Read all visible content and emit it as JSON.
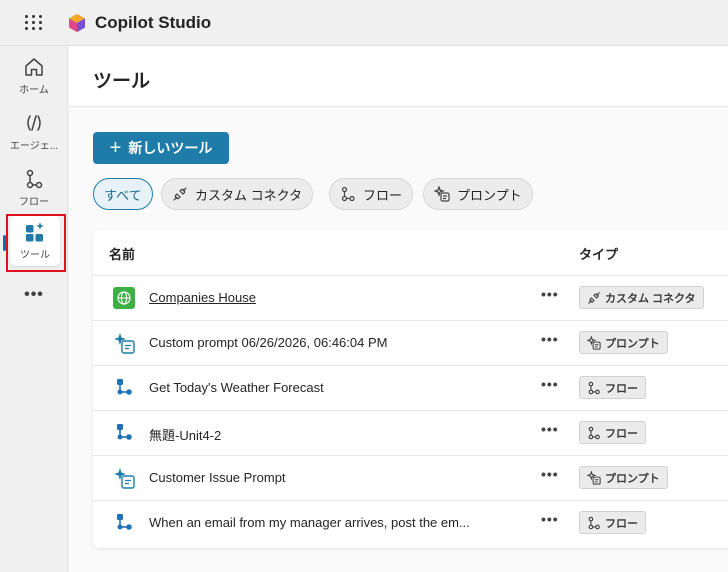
{
  "app": {
    "title": "Copilot Studio"
  },
  "nav": {
    "items": [
      {
        "label": "ホーム",
        "icon": "home-icon"
      },
      {
        "label": "エージェ...",
        "icon": "agents-icon"
      },
      {
        "label": "フロー",
        "icon": "flow-icon"
      },
      {
        "label": "ツール",
        "icon": "tools-icon",
        "active": true
      }
    ],
    "more": "•••"
  },
  "page": {
    "title": "ツール",
    "new_button": "新しいツール",
    "new_button_icon": "+"
  },
  "filters": [
    {
      "label": "すべて",
      "selected": true
    },
    {
      "label": "カスタム コネクタ",
      "icon": "connector-icon"
    },
    {
      "label": "フロー",
      "icon": "flow-icon"
    },
    {
      "label": "プロンプト",
      "icon": "prompt-icon"
    }
  ],
  "table": {
    "columns": [
      "名前",
      "タイプ"
    ],
    "rows": [
      {
        "name": "Companies House",
        "type": "カスタム コネクタ",
        "icon": "globe-icon",
        "type_icon": "connector-icon",
        "link": true
      },
      {
        "name": "Custom prompt 06/26/2026, 06:46:04 PM",
        "type": "プロンプト",
        "icon": "prompt-icon",
        "type_icon": "prompt-icon"
      },
      {
        "name": "Get Today's Weather Forecast",
        "type": "フロー",
        "icon": "flow-icon",
        "type_icon": "flow-icon"
      },
      {
        "name": "無題-Unit4-2",
        "type": "フロー",
        "icon": "flow-icon",
        "type_icon": "flow-icon"
      },
      {
        "name": "Customer Issue Prompt",
        "type": "プロンプト",
        "icon": "prompt-icon",
        "type_icon": "prompt-icon"
      },
      {
        "name": "When an email from my manager arrives, post the em...",
        "type": "フロー",
        "icon": "flow-icon",
        "type_icon": "flow-icon"
      }
    ],
    "row_more": "•••"
  },
  "colors": {
    "accent": "#1f7ba8",
    "highlight": "#e0101e",
    "flow_icon": "#1e73b8",
    "globe_icon": "#3cb043"
  }
}
